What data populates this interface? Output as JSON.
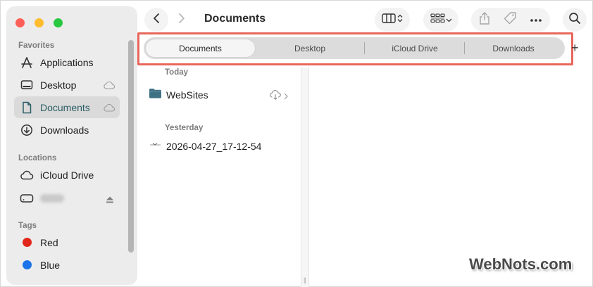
{
  "window": {
    "title": "Documents"
  },
  "sidebar": {
    "sections": [
      {
        "header": "Favorites",
        "items": [
          {
            "label": "Applications",
            "icon": "applications-icon"
          },
          {
            "label": "Desktop",
            "icon": "desktop-icon",
            "badge": "cloud-icon"
          },
          {
            "label": "Documents",
            "icon": "document-icon",
            "badge": "cloud-icon",
            "selected": true
          },
          {
            "label": "Downloads",
            "icon": "downloads-icon"
          }
        ]
      },
      {
        "header": "Locations",
        "items": [
          {
            "label": "iCloud Drive",
            "icon": "icloud-icon"
          },
          {
            "label": "",
            "icon": "drive-icon",
            "badge": "eject-icon",
            "redacted": true
          }
        ]
      },
      {
        "header": "Tags",
        "items": [
          {
            "label": "Red",
            "color": "#e3261b"
          },
          {
            "label": "Blue",
            "color": "#1a73e8"
          }
        ]
      }
    ]
  },
  "toolbar": {
    "back_icon": "chevron-left-icon",
    "forward_icon": "chevron-right-icon",
    "view_icon": "column-view-icon",
    "group_icon": "group-grid-icon",
    "share_icon": "share-icon",
    "tag_icon": "tag-icon",
    "more_icon": "ellipsis-icon",
    "search_icon": "search-icon"
  },
  "tabs": [
    {
      "label": "Documents",
      "active": true
    },
    {
      "label": "Desktop"
    },
    {
      "label": "iCloud Drive"
    },
    {
      "label": "Downloads"
    }
  ],
  "tabs_add_label": "+",
  "files": {
    "groups": [
      {
        "header": "Today",
        "items": [
          {
            "name": "WebSites",
            "type": "folder",
            "status": "cloud-download-icon"
          }
        ]
      },
      {
        "header": "Yesterday",
        "items": [
          {
            "name": "2026-04-27_17-12-54",
            "type": "file"
          }
        ]
      }
    ]
  },
  "watermark": "WebNots.com",
  "colors": {
    "highlight": "#e8665a",
    "selected_text": "#2a5d66",
    "folder": "#3f7184"
  }
}
